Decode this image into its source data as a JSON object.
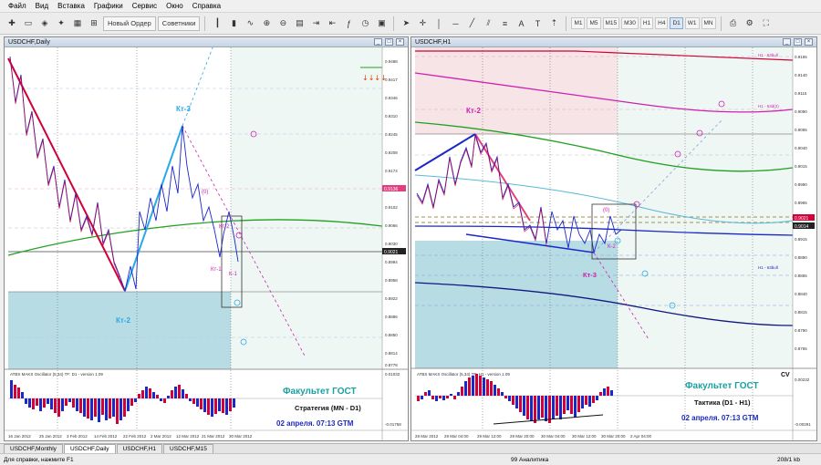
{
  "menu": [
    "Файл",
    "Вид",
    "Вставка",
    "Графики",
    "Сервис",
    "Окно",
    "Справка"
  ],
  "toolbar": {
    "new_order": "Новый Ордер",
    "advisors": "Советники",
    "timeframes": [
      "M1",
      "M5",
      "M15",
      "M30",
      "H1",
      "H4",
      "D1",
      "W1",
      "MN"
    ],
    "active_timeframe": "D1"
  },
  "left_window": {
    "title": "USDCHF,Daily",
    "prices": [
      "0.9488",
      "0.9417",
      "0.9346",
      "0.9310",
      "0.9245",
      "0.9208",
      "0.9174",
      "0.9138",
      "0.9102",
      "0.9066",
      "0.9030",
      "0.8994",
      "0.8958",
      "0.8922",
      "0.8886",
      "0.8850",
      "0.8814",
      "0.8778",
      "0.8752"
    ],
    "price_tags": {
      "bid": "0.9136",
      "current": "0.9021"
    },
    "dates": [
      "16 Jan 2012",
      "25 Jan 2012",
      "3 Feb 2012",
      "14 Feb 2012",
      "22 Feb 2012",
      "2 Mar 2012",
      "12 Mar 2012",
      "21 Mar 2012",
      "30 Mar 2012"
    ],
    "labels": {
      "kt3": "Кт-3",
      "kt2": "Кт-2",
      "kt2_small": "Кт-2",
      "kt1": "Кт-1",
      "k1": "К-1",
      "zero": "(0)"
    },
    "oscillator_title": "ATBS MAKS Oscillator (5,34) TF: D1 - version 1.09",
    "osc_values": [
      "0.01032",
      "-0.01758"
    ],
    "faculty": "Факультет ГОСТ",
    "strategy": "Стратегия (MN - D1)",
    "date_text": "02 апреля. 07:13 GTM"
  },
  "right_window": {
    "title": "USDCHF,H1",
    "prices": [
      "0.9165",
      "0.9140",
      "0.9115",
      "0.9090",
      "0.9065",
      "0.9040",
      "0.9015",
      "0.8990",
      "0.8965",
      "0.8940",
      "0.8915",
      "0.8890",
      "0.8865",
      "0.8840",
      "0.8815",
      "0.8790",
      "0.8765"
    ],
    "price_tags": {
      "bid": "0.9021",
      "current": "0.9014"
    },
    "dates": [
      "28 Mar 2012",
      "29 Mar 04:00",
      "29 Mar 12:00",
      "29 Mar 20:00",
      "30 Mar 04:00",
      "30 Mar 12:00",
      "30 Mar 20:00",
      "2 Apr 04:00"
    ],
    "labels": {
      "kt2": "Кт-2",
      "kt3": "Кт-3",
      "k2": "К-2",
      "zero": "(0)",
      "h1_top": "H1 - 63bull",
      "h1_mid": "H1 - 63d(2)",
      "h1_low": "H1 - 63bull",
      "cv": "CV"
    },
    "oscillator_title": "ATBS MAKS Oscillator (5,34) TF: H1 - version 1.09",
    "osc_values": [
      "0.00232",
      "-0.00291"
    ],
    "faculty": "Факультет ГОСТ",
    "strategy": "Тактика (D1 - H1)",
    "date_text": "02 апреля. 07:13 GTM"
  },
  "tabs": [
    "USDCHF,Monthly",
    "USDCHF,Daily",
    "USDCHF,H1",
    "USDCHF,M15"
  ],
  "active_tab": "USDCHF,Daily",
  "status": {
    "help": "Для справки, нажмите F1",
    "analytics": "99 Аналитика",
    "traffic": "208/1 kb"
  },
  "colors": {
    "red": "#d0003a",
    "blue": "#1a28c8",
    "cyan": "#2aa8e8",
    "green": "#20a020",
    "magenta": "#d020b0",
    "teal_text": "#1aa0a0",
    "zone": "#b8dce4"
  }
}
